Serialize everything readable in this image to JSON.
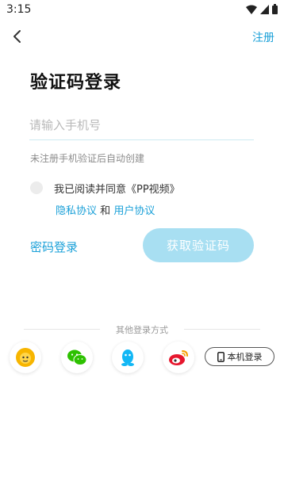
{
  "status_bar": {
    "time": "3:15"
  },
  "header": {
    "register_label": "注册"
  },
  "page": {
    "title": "验证码登录",
    "phone_placeholder": "请输入手机号",
    "hint": "未注册手机验证后自动创建"
  },
  "agreement": {
    "text": "我已阅读并同意《PP视频》",
    "privacy_label": "隐私协议",
    "and_label": "和",
    "user_label": "用户协议"
  },
  "actions": {
    "password_login_label": "密码登录",
    "get_code_label": "获取验证码"
  },
  "other_login": {
    "label": "其他登录方式",
    "local_login_label": "本机登录",
    "providers": [
      "suning-icon",
      "wechat-icon",
      "qq-icon",
      "weibo-icon"
    ]
  },
  "colors": {
    "accent": "#1aa0d8",
    "button_disabled": "#a8dff2"
  }
}
